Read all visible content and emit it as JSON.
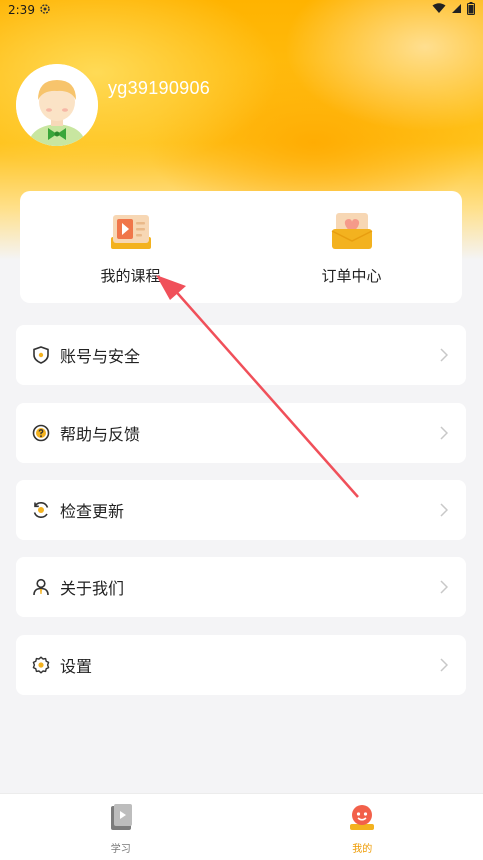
{
  "status_bar": {
    "time": "2:39"
  },
  "profile": {
    "username": "yg39190906"
  },
  "quick_actions": [
    {
      "label": "我的课程",
      "icon": "course-video-icon"
    },
    {
      "label": "订单中心",
      "icon": "order-envelope-icon"
    }
  ],
  "menu": [
    {
      "label": "账号与安全",
      "icon": "shield-icon"
    },
    {
      "label": "帮助与反馈",
      "icon": "help-question-icon"
    },
    {
      "label": "检查更新",
      "icon": "refresh-update-icon"
    },
    {
      "label": "关于我们",
      "icon": "person-icon"
    },
    {
      "label": "设置",
      "icon": "gear-icon"
    }
  ],
  "tabbar": [
    {
      "label": "学习",
      "icon": "study-book-icon",
      "active": false
    },
    {
      "label": "我的",
      "icon": "mine-face-icon",
      "active": true
    }
  ],
  "colors": {
    "accent": "#ffb300",
    "active_tab": "#ee9a00",
    "annotation_arrow": "#f0505a"
  }
}
